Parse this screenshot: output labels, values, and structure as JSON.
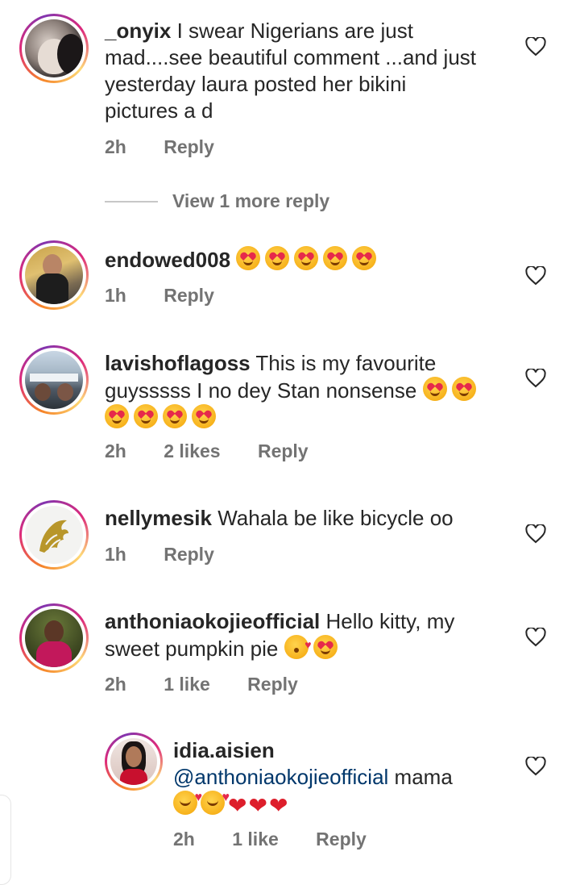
{
  "comments": [
    {
      "username": "_onyix",
      "text": "I swear Nigerians are just mad....see beautiful comment ...and just yesterday laura posted her bikini pictures a d",
      "time": "2h",
      "reply": "Reply"
    },
    {
      "username": "endowed008",
      "text": "",
      "time": "1h",
      "reply": "Reply"
    },
    {
      "username": "lavishoflagoss",
      "text": "This is my favourite guysssss I no dey Stan nonsense",
      "time": "2h",
      "likes": "2 likes",
      "reply": "Reply"
    },
    {
      "username": "nellymesik",
      "text": "Wahala be like bicycle oo",
      "time": "1h",
      "reply": "Reply"
    },
    {
      "username": "anthoniaokojieofficial",
      "text": "Hello kitty, my sweet pumpkin pie",
      "time": "2h",
      "likes": "1 like",
      "reply": "Reply"
    }
  ],
  "reply_comment": {
    "username": "idia.aisien",
    "mention": "@anthoniaokojieofficial",
    "text": "mama",
    "time": "2h",
    "likes": "1 like",
    "reply": "Reply"
  },
  "view_more": "View 1 more reply",
  "icons": {
    "like": "heart-outline-icon",
    "emoji_heart_eyes": "smiling-face-with-heart-eyes",
    "emoji_kiss": "face-blowing-a-kiss",
    "emoji_hug": "smiling-face-with-hearts",
    "emoji_red_heart": "red-heart"
  },
  "colors": {
    "text": "#262626",
    "meta": "#737373",
    "mention": "#00376b"
  }
}
